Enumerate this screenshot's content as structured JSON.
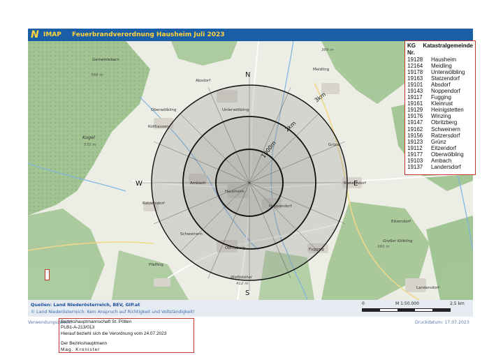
{
  "header": {
    "app_name": "IMAP",
    "title": "Feuerbrandverordnung Hausheim Juli 2023"
  },
  "map": {
    "compass": {
      "north": "N",
      "east": "E",
      "south": "S",
      "west": "W"
    },
    "ring_labels": {
      "r1": "1000m",
      "r2": "2km",
      "r3": "3km"
    },
    "places": [
      {
        "name": "Unterwölbling"
      },
      {
        "name": "Oberwölbling"
      },
      {
        "name": "Kollhausen"
      },
      {
        "name": "Hausheim"
      },
      {
        "name": "Ambach"
      },
      {
        "name": "Ratzersdorf"
      },
      {
        "name": "Noppendorf"
      },
      {
        "name": "Statzendorf"
      },
      {
        "name": "Schweinern"
      },
      {
        "name": "Obritzberg"
      },
      {
        "name": "Fugging"
      },
      {
        "name": "Kogel"
      },
      {
        "name": "Wolfsbühel"
      },
      {
        "name": "Gemeinlebarn"
      },
      {
        "name": "Pfaffing"
      },
      {
        "name": "Absdorf"
      },
      {
        "name": "Landersdorf"
      },
      {
        "name": "Großer Kölbling"
      },
      {
        "name": "Meidling"
      },
      {
        "name": "Eitzendorf"
      },
      {
        "name": "Grünz"
      }
    ],
    "elevations": [
      "569 m",
      "572 m",
      "389 m",
      "412 m",
      "393 m"
    ]
  },
  "footer": {
    "sources": "Quellen: Land Niederösterreich, BEV, GIP.at",
    "copyright": "© Land Niederösterreich: Kein Anspruch auf Richtigkeit und Vollständigkeit!",
    "scale_zero": "0",
    "scale_ratio": "M 1:50.000",
    "scale_end": "2,5 km"
  },
  "meta": {
    "purpose_label": "Verwendungszweck:",
    "print_date": "Druckdatum: 17.07.2023"
  },
  "infobox": {
    "line1": "Bezirkshauptmannschaft  St. Pölten",
    "line2": "PLB1-A-213/013",
    "line3": "Hierauf bezieht sich die Verordnung vom 24.07.2023",
    "line4": "Der Bezirkshauptmann",
    "line5": "Mag. Kronister"
  },
  "legend": {
    "col1": "KG Nr.",
    "col2": "Katastralgemeinde",
    "rows": [
      {
        "nr": "19128",
        "name": "Hausheim"
      },
      {
        "nr": "12164",
        "name": "Meidling"
      },
      {
        "nr": "19178",
        "name": "Unterwölbling"
      },
      {
        "nr": "19163",
        "name": "Statzendorf"
      },
      {
        "nr": "19101",
        "name": "Absdorf"
      },
      {
        "nr": "19143",
        "name": "Noppendorf"
      },
      {
        "nr": "19117",
        "name": "Fugging"
      },
      {
        "nr": "19161",
        "name": "Kleinrust"
      },
      {
        "nr": "19129",
        "name": "Heinigstetten"
      },
      {
        "nr": "19176",
        "name": "Winzing"
      },
      {
        "nr": "19147",
        "name": "Obritzberg"
      },
      {
        "nr": "19162",
        "name": "Schweinern"
      },
      {
        "nr": "19156",
        "name": "Ratzersdorf"
      },
      {
        "nr": "19123",
        "name": "Grünz"
      },
      {
        "nr": "19112",
        "name": "Eitzendorf"
      },
      {
        "nr": "19177",
        "name": "Oberwölbling"
      },
      {
        "nr": "19103",
        "name": "Ambach"
      },
      {
        "nr": "19137",
        "name": "Landersdorf"
      }
    ]
  }
}
